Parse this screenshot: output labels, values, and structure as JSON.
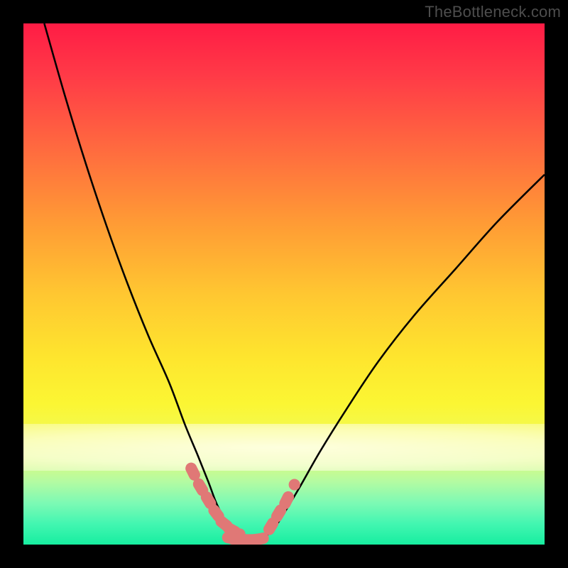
{
  "watermark": "TheBottleneck.com",
  "chart_data": {
    "type": "line",
    "title": "",
    "xlabel": "",
    "ylabel": "",
    "xlim": [
      0,
      100
    ],
    "ylim": [
      0,
      100
    ],
    "grid": false,
    "legend": false,
    "series": [
      {
        "name": "bottleneck-curve-left",
        "x": [
          4,
          8,
          12,
          16,
          20,
          24,
          28,
          31,
          33.5,
          35.5,
          37,
          38.5,
          40,
          42
        ],
        "values": [
          100,
          86,
          73,
          61,
          50,
          40,
          31,
          23,
          17,
          12,
          8,
          5,
          2.5,
          1.2
        ]
      },
      {
        "name": "bottleneck-curve-right",
        "x": [
          46,
          48,
          50,
          53,
          57,
          62,
          68,
          75,
          83,
          91,
          100
        ],
        "values": [
          1.2,
          3,
          6,
          11,
          18,
          26,
          35,
          44,
          53,
          62,
          71
        ]
      },
      {
        "name": "sausage-points-left",
        "x": [
          32.5,
          34,
          35.5,
          37,
          38.5,
          40,
          41.5
        ],
        "values": [
          14,
          11,
          8.5,
          6,
          4,
          2.8,
          2
        ]
      },
      {
        "name": "sausage-points-right",
        "x": [
          47.5,
          49,
          50.5,
          52
        ],
        "values": [
          3.5,
          6,
          8.5,
          11.5
        ]
      },
      {
        "name": "flat-bottom",
        "x": [
          40,
          41,
          42,
          43,
          44,
          45,
          46
        ],
        "values": [
          1.2,
          1.0,
          0.9,
          0.9,
          0.9,
          1.0,
          1.2
        ]
      }
    ],
    "annotations": [],
    "colors": {
      "curve": "#000000",
      "sausage": "#e57373",
      "background_top": "#ff1c45",
      "background_bottom": "#17eea0"
    }
  }
}
